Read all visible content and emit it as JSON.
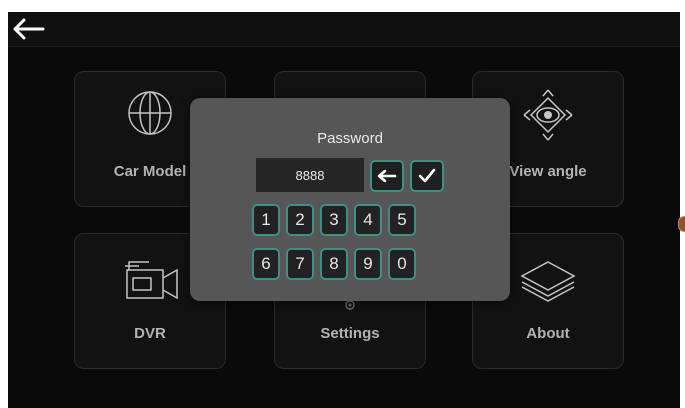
{
  "tiles": {
    "car_model": "Car Model",
    "view_angle": "View angle",
    "dvr": "DVR",
    "settings": "Settings",
    "about": "About"
  },
  "dialog": {
    "title": "Password",
    "value": "8888",
    "keys_row1": [
      "1",
      "2",
      "3",
      "4",
      "5"
    ],
    "keys_row2": [
      "6",
      "7",
      "8",
      "9",
      "0"
    ]
  },
  "icons": {
    "back": "back-arrow-icon",
    "globe": "globe-icon",
    "eye": "eye-view-icon",
    "camera": "video-camera-icon",
    "gear": "gear-icon",
    "layers": "layers-icon",
    "backspace": "backspace-arrow-icon",
    "check": "checkmark-icon"
  },
  "colors": {
    "background": "#0b0b0b",
    "dialog": "#565656",
    "key_border": "#3f8f87"
  }
}
